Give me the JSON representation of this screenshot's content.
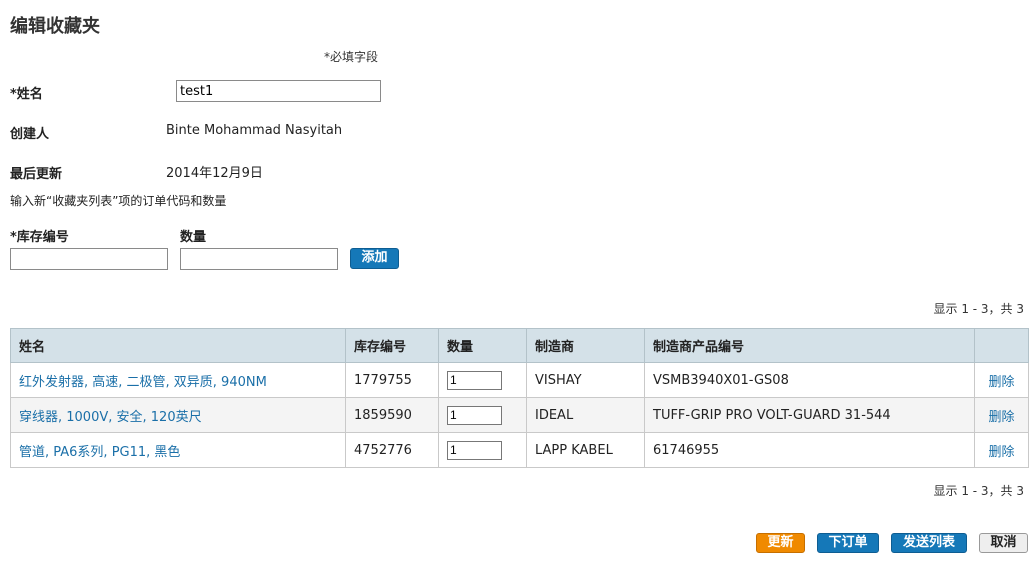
{
  "page": {
    "title": "编辑收藏夹",
    "required_note": "*必填字段"
  },
  "form": {
    "name_label": "*姓名",
    "name_value": "test1",
    "creator_label": "创建人",
    "creator_value": "Binte Mohammad Nasyitah",
    "updated_label": "最后更新",
    "updated_value": "2014年12月9日",
    "instructions": "输入新“收藏夹列表”项的订单代码和数量",
    "stock_label": "*库存编号",
    "stock_value": "",
    "qty_label": "数量",
    "qty_value": "",
    "add_button": "添加"
  },
  "results": {
    "top": "显示 1 - 3，共 3",
    "bottom": "显示 1 - 3，共 3"
  },
  "table": {
    "headers": [
      "姓名",
      "库存编号",
      "数量",
      "制造商",
      "制造商产品编号",
      ""
    ],
    "rows": [
      {
        "name": "红外发射器, 高速, 二极管, 双异质, 940NM",
        "stock": "1779755",
        "qty": "1",
        "manufacturer": "VISHAY",
        "mpn": "VSMB3940X01-GS08",
        "delete": "删除"
      },
      {
        "name": "穿线器, 1000V, 安全, 120英尺",
        "stock": "1859590",
        "qty": "1",
        "manufacturer": "IDEAL",
        "mpn": "TUFF-GRIP PRO VOLT-GUARD 31-544",
        "delete": "删除"
      },
      {
        "name": "管道, PA6系列, PG11, 黑色",
        "stock": "4752776",
        "qty": "1",
        "manufacturer": "LAPP KABEL",
        "mpn": "61746955",
        "delete": "删除"
      }
    ]
  },
  "actions": {
    "update": "更新",
    "order": "下订单",
    "send": "发送列表",
    "cancel": "取消"
  },
  "colors": {
    "accent_blue": "#1578b8",
    "accent_orange": "#f08a00",
    "header_bg": "#d4e1e8",
    "link": "#1a6fa8"
  }
}
